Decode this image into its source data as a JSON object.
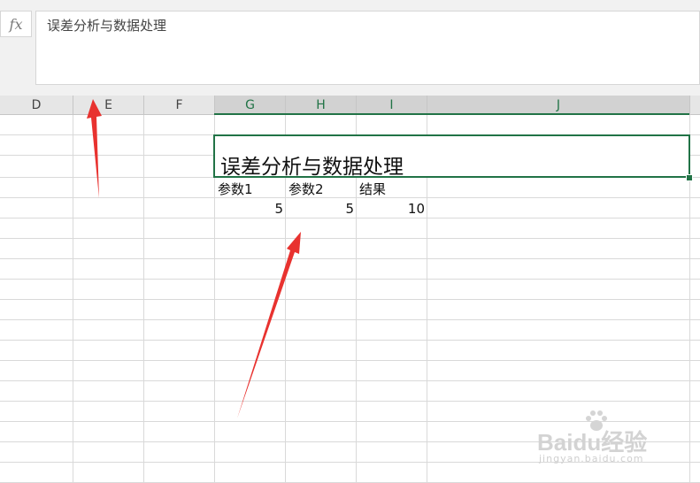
{
  "formula_bar": {
    "fx_label": "fx",
    "content": "误差分析与数据处理"
  },
  "columns": [
    "D",
    "E",
    "F",
    "G",
    "H",
    "I",
    "J"
  ],
  "selected_columns": [
    "G",
    "H",
    "I",
    "J"
  ],
  "sheet": {
    "title": "误差分析与数据处理",
    "headers": [
      "参数1",
      "参数2",
      "结果"
    ],
    "values": [
      "5",
      "5",
      "10"
    ]
  },
  "annotations": {
    "arrow_color": "#e8322f"
  },
  "accent_color": "#217346",
  "watermark": {
    "logo": "Baidu经验",
    "url": "jingyan.baidu.com"
  }
}
